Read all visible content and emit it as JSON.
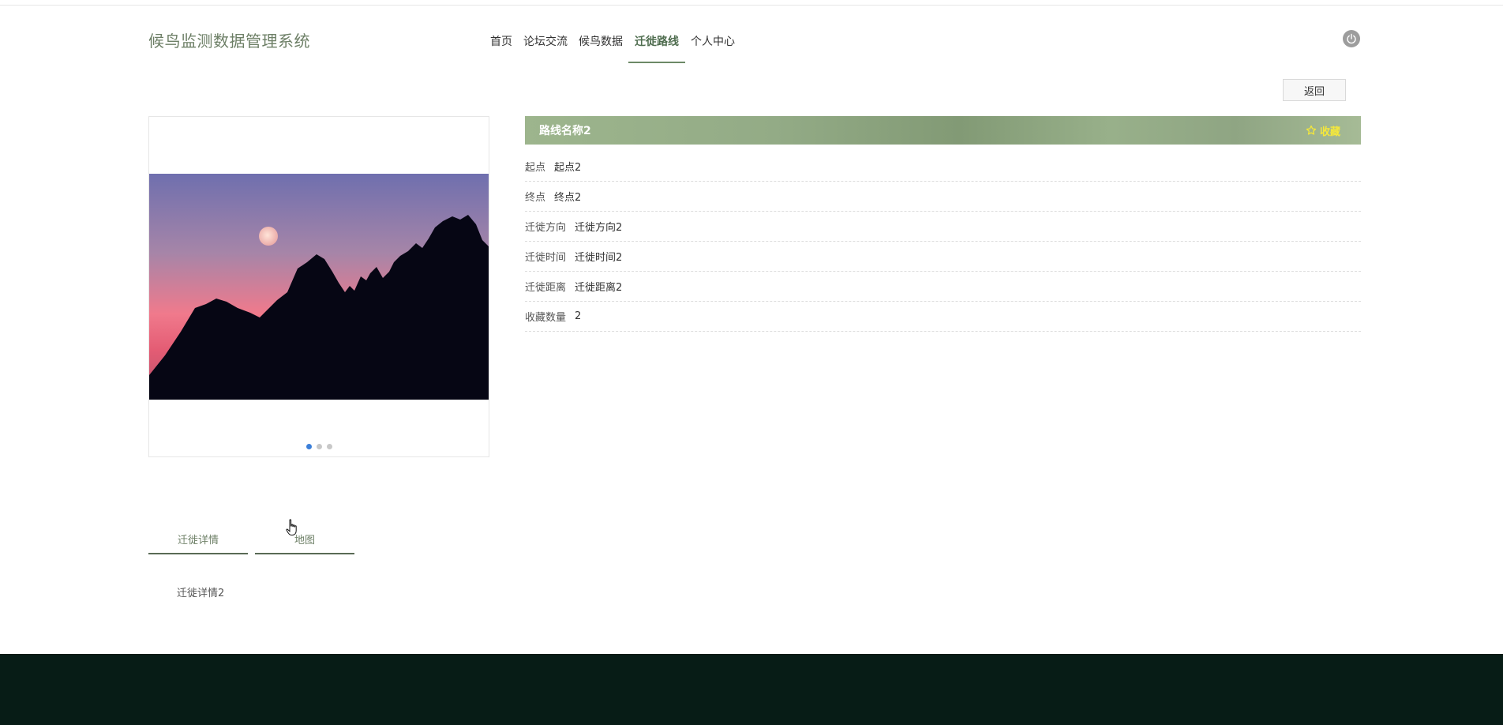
{
  "brand": {
    "title": "候鸟监测数据管理系统"
  },
  "nav": {
    "items": [
      {
        "label": "首页"
      },
      {
        "label": "论坛交流"
      },
      {
        "label": "候鸟数据"
      },
      {
        "label": "迁徙路线"
      },
      {
        "label": "个人中心"
      }
    ],
    "active_index": 3
  },
  "actions": {
    "back_label": "返回"
  },
  "detail": {
    "route_name": "路线名称2",
    "favorite_label": "收藏",
    "fields": [
      {
        "label": "起点",
        "value": "起点2"
      },
      {
        "label": "终点",
        "value": "终点2"
      },
      {
        "label": "迁徙方向",
        "value": "迁徙方向2"
      },
      {
        "label": "迁徙时间",
        "value": "迁徙时间2"
      },
      {
        "label": "迁徙距离",
        "value": "迁徙距离2"
      },
      {
        "label": "收藏数量",
        "value": "2"
      }
    ]
  },
  "carousel": {
    "slides": 3,
    "active_slide": 1
  },
  "tabs": {
    "items": [
      {
        "label": "迁徙详情"
      },
      {
        "label": "地图"
      }
    ],
    "active_index": 0,
    "content": "迁徙详情2"
  },
  "colors": {
    "brand_text": "#6d7f66",
    "header_green": "#93ab86",
    "favorite_yellow": "#f5e83a",
    "footer_bg": "#071c16",
    "dot_active": "#3b7fd9"
  }
}
